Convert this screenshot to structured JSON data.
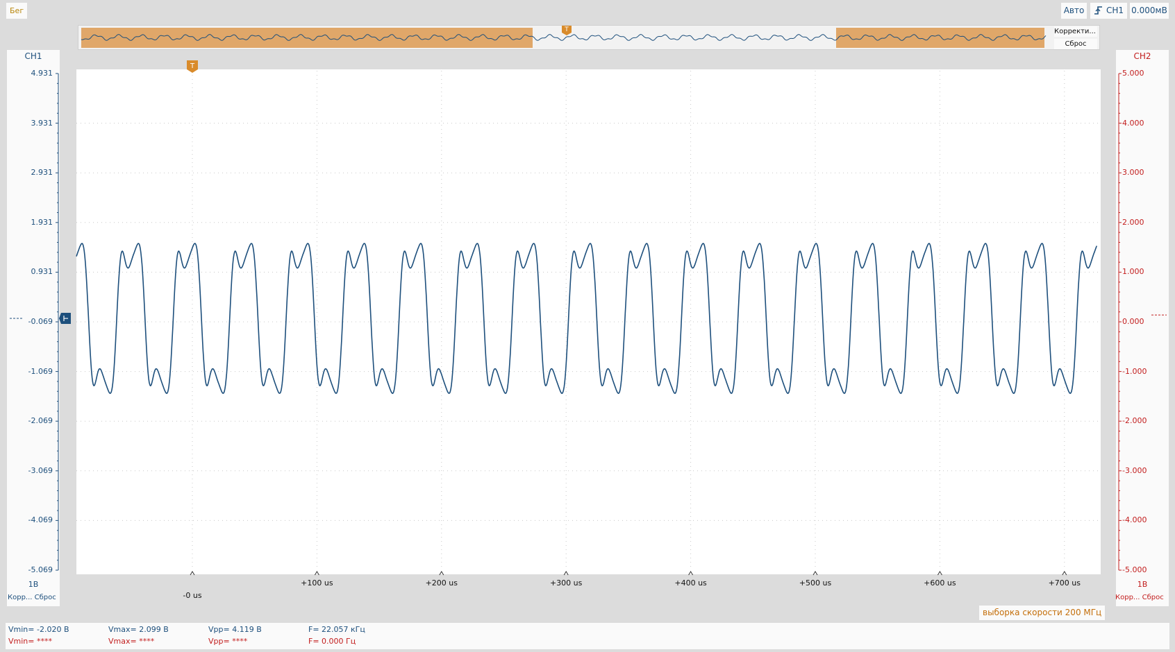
{
  "toolbar": {
    "run_status": "Бег",
    "trigger_mode": "Авто",
    "trigger_source": "CH1",
    "trigger_level": "0.000мВ"
  },
  "overview": {
    "correction_label": "Корректи...",
    "reset_label": "Сброс",
    "trigger_marker": "T"
  },
  "ch1": {
    "title": "CH1",
    "axis_labels": [
      "4.931",
      "3.931",
      "2.931",
      "1.931",
      "0.931",
      "-0.069",
      "-1.069",
      "-2.069",
      "-3.069",
      "-4.069",
      "-5.069"
    ],
    "scale": "1В",
    "corr_label": "Корр...",
    "reset_label": "Сброс",
    "color": "#1d4f7c"
  },
  "ch2": {
    "title": "CH2",
    "axis_labels": [
      "5.000",
      "4.000",
      "3.000",
      "2.000",
      "1.000",
      "0.000",
      "-1.000",
      "-2.000",
      "-3.000",
      "-4.000",
      "-5.000"
    ],
    "scale": "1В",
    "corr_label": "Корр... Сброс",
    "color": "#c21d1d"
  },
  "time_axis": {
    "labels": [
      "-0 us",
      "+100 us",
      "+200 us",
      "+300 us",
      "+400 us",
      "+500 us",
      "+600 us",
      "+700 us"
    ]
  },
  "trigger_marker": "T",
  "sample_rate": "выборка скорости 200 МГц",
  "measurements": {
    "ch1": {
      "vmin": "Vmin= -2.020 В",
      "vmax": "Vmax= 2.099 В",
      "vpp": "Vpp= 4.119 В",
      "freq": "F= 22.057 кГц"
    },
    "ch2": {
      "vmin": "Vmin= ****",
      "vmax": "Vmax= ****",
      "vpp": "Vpp= ****",
      "freq": "F= 0.000 Гц"
    }
  },
  "chart_data": {
    "type": "line",
    "x_unit": "us",
    "xlim": [
      -92,
      730
    ],
    "ylim": [
      -5.069,
      4.931
    ],
    "grid": true,
    "series": [
      {
        "name": "CH1",
        "period_us": 45.33,
        "max": 2.099,
        "min": -2.02
      }
    ]
  }
}
